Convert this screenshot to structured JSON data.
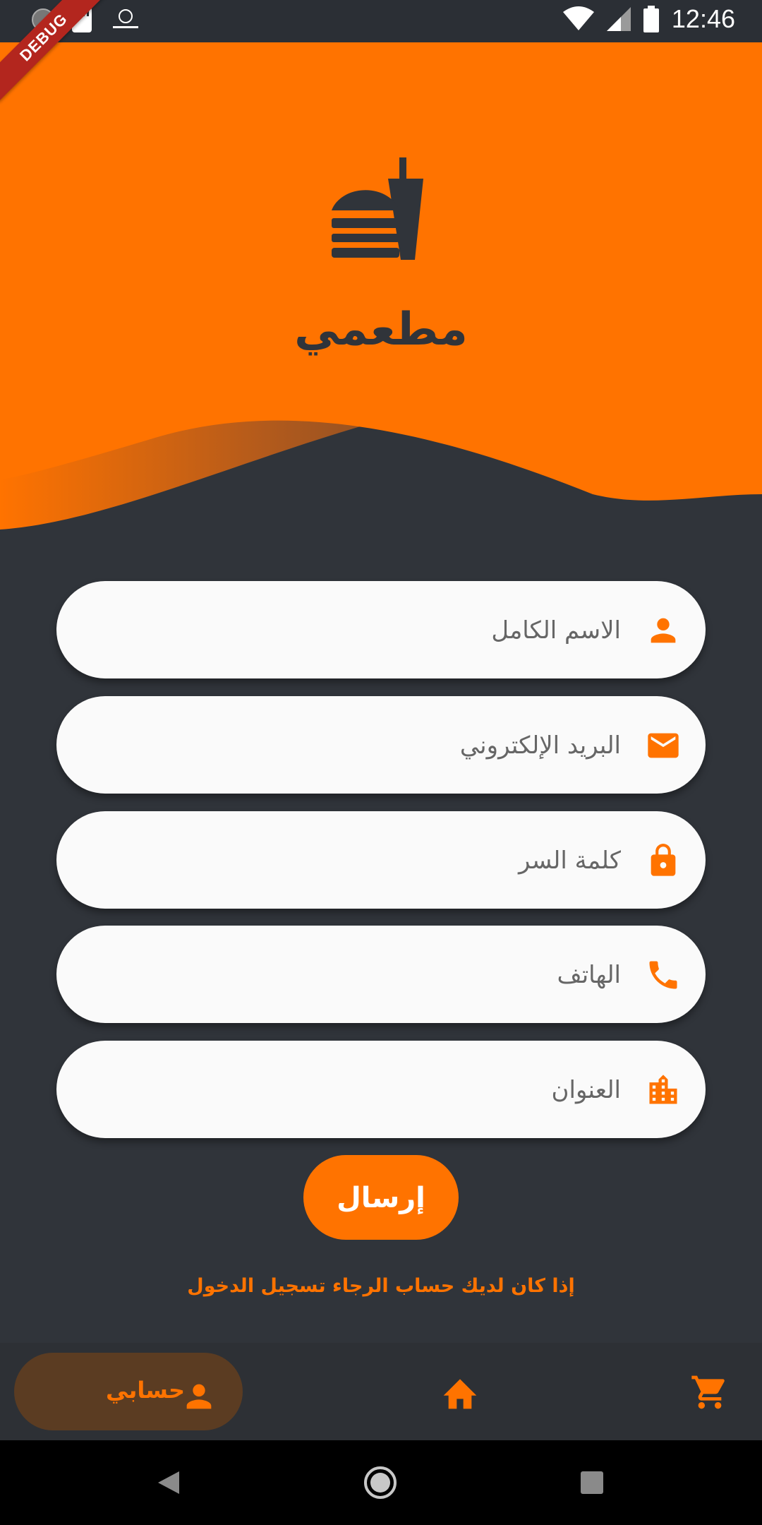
{
  "status": {
    "time": "12:46"
  },
  "debug_banner": "DEBUG",
  "header": {
    "title": "مطعمي"
  },
  "form": {
    "full_name_placeholder": "الاسم الكامل",
    "email_placeholder": "البريد الإلكتروني",
    "password_placeholder": "كلمة السر",
    "phone_placeholder": "الهاتف",
    "address_placeholder": "العنوان",
    "submit_label": "إرسال",
    "login_prompt": "إذا كان لديك حساب الرجاء تسجيل الدخول"
  },
  "bottom_nav": {
    "account_label": "حسابي"
  },
  "colors": {
    "accent": "#ff7300",
    "background": "#30343a",
    "field": "#fafafa"
  }
}
